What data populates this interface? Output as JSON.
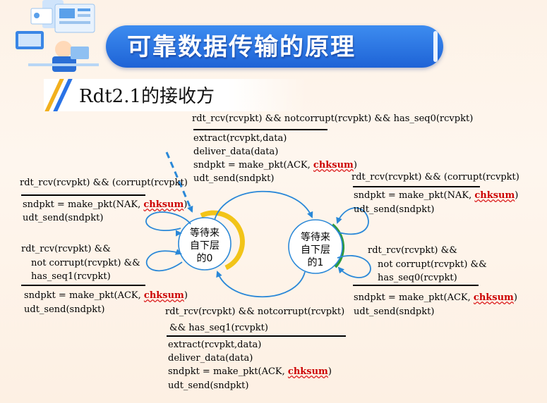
{
  "header": {
    "title": "可靠数据传输的原理",
    "subtitle": "Rdt2.1的接收方"
  },
  "colors": {
    "header_blue": "#2a73e6",
    "arrow_blue": "#2a88d8",
    "state0_accent": "#f2c418",
    "state1_accent": "#2e9a3a",
    "checksum_red": "#c00000"
  },
  "states": {
    "state0": [
      "等待来",
      "自下层",
      "的0"
    ],
    "state1": [
      "等待来",
      "自下层",
      "的1"
    ]
  },
  "transitions": {
    "top": {
      "event": "rdt_rcv(rcvpkt) && notcorrupt(rcvpkt)  && has_seq0(rcvpkt)",
      "actions": [
        "extract(rcvpkt,data)",
        "deliver_data(data)",
        "sndpkt = make_pkt(ACK, ",
        "udt_send(sndpkt)"
      ]
    },
    "left_upper": {
      "event": "rdt_rcv(rcvpkt) && (corrupt(rcvpkt)",
      "actions": [
        "sndpkt = make_pkt(NAK, ",
        "udt_send(sndpkt)"
      ]
    },
    "left_lower": {
      "event": [
        "rdt_rcv(rcvpkt) &&",
        "not corrupt(rcvpkt) &&",
        "has_seq1(rcvpkt)"
      ],
      "actions": [
        "sndpkt = make_pkt(ACK, ",
        "udt_send(sndpkt)"
      ]
    },
    "right_upper": {
      "event": "rdt_rcv(rcvpkt) && (corrupt(rcvpkt)",
      "actions": [
        "sndpkt = make_pkt(NAK, ",
        "udt_send(sndpkt)"
      ]
    },
    "right_lower": {
      "event": [
        "rdt_rcv(rcvpkt) &&",
        "not corrupt(rcvpkt) &&",
        "has_seq0(rcvpkt)"
      ],
      "actions": [
        "sndpkt = make_pkt(ACK, ",
        "udt_send(sndpkt)"
      ]
    },
    "bottom": {
      "event": [
        "rdt_rcv(rcvpkt) && notcorrupt(rcvpkt)",
        "&& has_seq1(rcvpkt)"
      ],
      "actions": [
        "extract(rcvpkt,data)",
        "deliver_data(data)",
        "sndpkt = make_pkt(ACK, ",
        "udt_send(sndpkt)"
      ]
    },
    "checksum_word": "chksum",
    "close_paren": ")"
  }
}
